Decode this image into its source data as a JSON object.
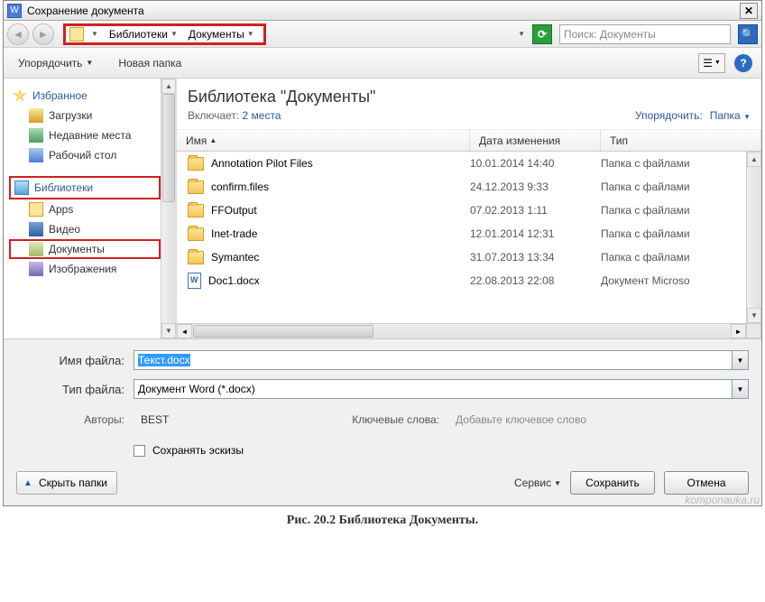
{
  "window": {
    "title": "Сохранение документа"
  },
  "nav": {
    "breadcrumb": [
      "Библиотеки",
      "Документы"
    ],
    "search_placeholder": "Поиск: Документы"
  },
  "toolbar": {
    "organize": "Упорядочить",
    "new_folder": "Новая папка"
  },
  "sidebar": {
    "favorites": {
      "label": "Избранное",
      "children": [
        {
          "label": "Загрузки",
          "icon": "dl"
        },
        {
          "label": "Недавние места",
          "icon": "rec"
        },
        {
          "label": "Рабочий стол",
          "icon": "desk"
        }
      ]
    },
    "libraries": {
      "label": "Библиотеки",
      "children": [
        {
          "label": "Apps",
          "icon": "apps"
        },
        {
          "label": "Видео",
          "icon": "vid"
        },
        {
          "label": "Документы",
          "icon": "doc",
          "highlight": true
        },
        {
          "label": "Изображения",
          "icon": "img"
        }
      ]
    }
  },
  "library": {
    "title": "Библиотека \"Документы\"",
    "includes_label": "Включает:",
    "includes_value": "2 места",
    "sort_label": "Упорядочить:",
    "sort_value": "Папка"
  },
  "columns": {
    "name": "Имя",
    "date": "Дата изменения",
    "type": "Тип"
  },
  "files": [
    {
      "name": "Annotation Pilot Files",
      "date": "10.01.2014 14:40",
      "type": "Папка с файлами",
      "kind": "folder"
    },
    {
      "name": "confirm.files",
      "date": "24.12.2013 9:33",
      "type": "Папка с файлами",
      "kind": "folder"
    },
    {
      "name": "FFOutput",
      "date": "07.02.2013 1:11",
      "type": "Папка с файлами",
      "kind": "folder"
    },
    {
      "name": "Inet-trade",
      "date": "12.01.2014 12:31",
      "type": "Папка с файлами",
      "kind": "folder"
    },
    {
      "name": "Symantec",
      "date": "31.07.2013 13:34",
      "type": "Папка с файлами",
      "kind": "folder"
    },
    {
      "name": "Doc1.docx",
      "date": "22.08.2013 22:08",
      "type": "Документ Microso",
      "kind": "docx"
    }
  ],
  "fields": {
    "name_label": "Имя файла:",
    "name_value": "Текст.docx",
    "type_label": "Тип файла:",
    "type_value": "Документ Word (*.docx)",
    "authors_label": "Авторы:",
    "authors_value": "BEST",
    "keywords_label": "Ключевые слова:",
    "keywords_placeholder": "Добавьте ключевое слово",
    "thumbs_label": "Сохранять эскизы"
  },
  "buttons": {
    "hide_folders": "Скрыть папки",
    "service": "Сервис",
    "save": "Сохранить",
    "cancel": "Отмена"
  },
  "watermark": "komponauka.ru",
  "caption": "Рис. 20.2 Библиотека Документы."
}
